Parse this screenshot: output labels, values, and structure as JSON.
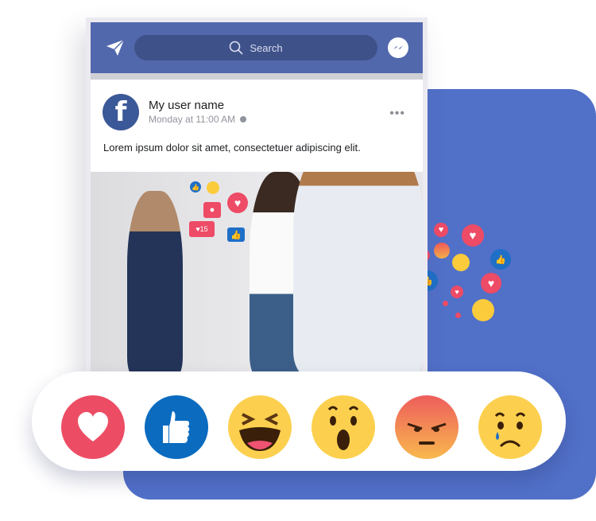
{
  "header": {
    "search_placeholder": "Search",
    "icons": [
      "send-icon",
      "search-icon",
      "messenger-icon"
    ]
  },
  "post": {
    "username": "My user name",
    "timestamp": "Monday at 11:00 AM",
    "privacy_icon": "globe-icon",
    "more_label": "•••",
    "text": "Lorem ipsum dolor sit amet, consectetuer adipiscing elit.",
    "avatar_letter": "f",
    "notification_count": "15"
  },
  "reactions": [
    {
      "name": "love",
      "color": "#ec4d64"
    },
    {
      "name": "like",
      "color": "#0a6bbf"
    },
    {
      "name": "haha",
      "color": "#fcd04e"
    },
    {
      "name": "wow",
      "color": "#fcd04e"
    },
    {
      "name": "angry",
      "color": "#ee5d5c"
    },
    {
      "name": "sad",
      "color": "#fcd04e"
    }
  ],
  "colors": {
    "brand": "#5268ad",
    "background_card": "#5170c8",
    "search_field": "#3f5189"
  }
}
